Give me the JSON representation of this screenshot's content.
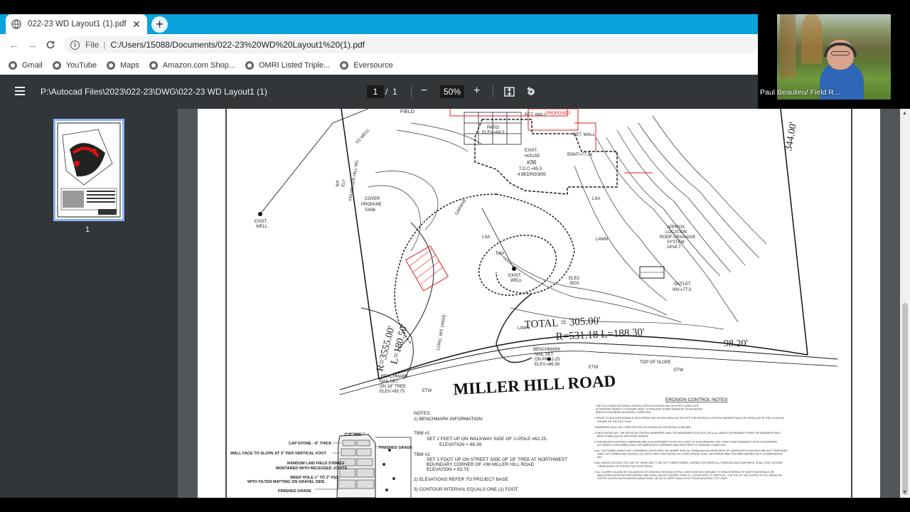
{
  "browser": {
    "tab_title": "022-23 WD Layout1 (1).pdf",
    "close_glyph": "✕",
    "newtab_glyph": "+",
    "url_scheme": "File",
    "url": "C:/Users/15088/Documents/022-23%20WD%20Layout1%20(1).pdf",
    "bookmarks": [
      "Gmail",
      "YouTube",
      "Maps",
      "Amazon.com Shop...",
      "OMRI Listed Triple...",
      "Eversource"
    ]
  },
  "webcam": {
    "participant_name": "Paul Beaulieu/ Field R..."
  },
  "pdf": {
    "path_title": "P:\\Autocad Files\\2023\\022-23\\DWG\\022-23 WD Layout1 (1)",
    "current_page": "1",
    "page_sep": "/",
    "total_pages": "1",
    "zoom": "50%",
    "thumbnail_label": "1"
  },
  "drawing": {
    "road_name": "MILLER   HILL   ROAD",
    "curve_total": "TOTAL = 305.00'",
    "curve_params": "R=531.18  L=188.30'",
    "dist_right": "98.20'",
    "dist_top_right": "344.00'",
    "radius_left": "R=3555.00'",
    "radius_left2": "L=180.50'",
    "house": [
      "EXIST.",
      "HOUSE",
      "#36",
      "T.O.C.=85.5",
      "4 BEDROOMS"
    ],
    "labels": {
      "field": "FIELD",
      "patio": "PATIO",
      "patio_elev": "ELEV.=84.5",
      "ret_wall": "RET. WALL",
      "ret_wall2": "RET. WALL",
      "proposed_patio": "PROPOSED",
      "bsmt": "BSMT=77.2±",
      "lsa": "LSA",
      "lawn": "LAWN",
      "lawn2": "LAWN",
      "exist_well": "EXIST.",
      "well": "WELL",
      "exist_well2": "EXIST.",
      "well2": "WELL",
      "cover": "COVER",
      "propane": "PROPANE",
      "tank": "TANK",
      "garage": "GARAGE",
      "approx": "APPROX.",
      "location": "LOCATION",
      "roof_drain": "ROOF DRAINAGE",
      "system": "SYSTEM",
      "elev_187": "18'x8.7'",
      "outlet": "OUTLET",
      "inv": "INV.=77.0",
      "elec": "ELEC",
      "box": "BOX",
      "benchmark": "BENCHMARK",
      "nail_set": "NAIL SET",
      "on_pp": "ON PP 62-25",
      "elev_bm": "ELEV.=86.39",
      "benchmark2": "BENCHMARK",
      "nail_set2": "NAIL SET",
      "on_tree": "ON 18\" TREE",
      "elev_bm2": "ELEV.=93.75",
      "top_of_slope": "TOP OF SLOPE",
      "etw": "ETW",
      "etw2": "ETW",
      "etw3": "ETW",
      "drive": "CONC. BIT. DRIVE",
      "nf": "N/F",
      "nf2": "ELY",
      "nf3": "#34 MILLER HILL RD.",
      "to_well": "TO WELL"
    },
    "notes_title": "NOTES:",
    "notes": [
      "1)  BENCHMARK INFORMATION:",
      "TBM #1",
      "SET 2 FEET UP ON WALKWAY SIDE OF U-POLE #62-25.",
      "ELEVATION = 86.39",
      "TBM #2",
      "SET 1 FOOT UP ON STREET SIDE OF 18\" TREE AT NORTHWEST",
      "BOUNDARY CORNER OF #36 MILLER HILL ROAD",
      "ELEVATION = 93.75",
      "2)  ELEVATIONS REFER TO PROJECT BASE",
      "3)  CONTOUR INTERVAL EQUALS ONE (1) FOOT."
    ],
    "erosion_title": "EROSION CONTROL NOTES",
    "erosion_lines": [
      "THE FOLLOWING EROSION CONTROL SPECIFICATIONS ARE IN EFFECT WHEN SITE",
      "ALTERATION WORK IS CONTEMPLATED TO PREVENT DOWN GRADIENT OR ADJACENT",
      "AREAS FROM BEING ADVERSELY IMPACTED.",
      "1.PRIOR TO ANY DISTURBANCE OR ALTERATIONS ON ANY AREA ON THE SITE THE EROSION CONTROL BARRIER SHALL BE INSTALLED IN THE LOCATION",
      "SHOWN ON THE SITE PLAN.",
      "2.BARRIERS SHALL BE CONSTRUCTED AS SHOWN ON THE DETAIL ATTACHED.",
      "3.ONCE INSTALLED, THE EROSION CONTROL BARRIERS SHALL BE MAINTAINED IN PLACE UNTIL ALL AREAS UPGRADIENT FROM THE BARRIERS HAVE",
      "BEEN STABILIZED AS SPECIFIED HEREIN.",
      "4.THE EROSION CONTROL BARRIERS ARE ALSO INTENDED TO ACT AS A LIMIT OF DISTURBANCE. ANY LAND DOWN GRADIENT FROM THE BARRIER",
      "ACCIDENTLY DISTURBED SHALL BE IMMEDIATELY REPAIRED AND RESTORED TO ORIGINAL CONDITION.",
      "5.ALL DISTURBED AREAS NOT OTHERWISE DEVELOPED OR WHERE SPECIAL STABILIZATION MEASURES OR LANDSCAPE PLANTINGS ARE NOT PROPOSED",
      "SHALL BE LOAMED AND SEEDED. NO LESS THAN FOUR INCHES OF LOAM TOPSOIL SHALL BE SPREAD AND THE AREA SEEDED WITH CONSERVATION",
      "MIX.",
      "6.ALL AREAS OUTSIDE THE LIMIT OF WORK ARE TO BE LEFT UNDISTURBED. DURING SITE WORK ALL PERSONS AND EQUIPMENT SHALL STAY OUTSIDE",
      "THESE AREAS OF PROTECTED VEGETATION.",
      "7.ALL SLOPES CAUSED BY EXCAVATION OF EXISTING GROUND OR FILL OVER EXISTING GROUND TO CREATE BERMS OF EARTH MATERIALS OR",
      "RESULTING FROM RECONTOURING LAND SHALL BE NO STEEPER THAN 3:1, HORIZONTAL TO VERTICAL. THE TOE OF THE SLOPES IN FILL AREAS OR",
      "TOP OF SLOPES IN EXCAVATED AREAS SHALL BE NO CLOSER THAN 5 FEET FROM ADJACENT LOT LINES."
    ],
    "wall_detail": [
      "CAP STONE - 8\" THICK",
      "WALL FACE TO SLOPE AT 3\" PER VERTICAL FOOT",
      "RANDOM LAID FIELD STONES",
      "MORTARED WITH RECESSED JOINTS",
      "WEEP HOLE 1\" TO 2\" PVC",
      "WITH FILTER MATTING ON GRAVEL SIDE",
      "FINISHED GRADE",
      "FINISHED GRADE",
      "3'-0\" MIN."
    ]
  }
}
